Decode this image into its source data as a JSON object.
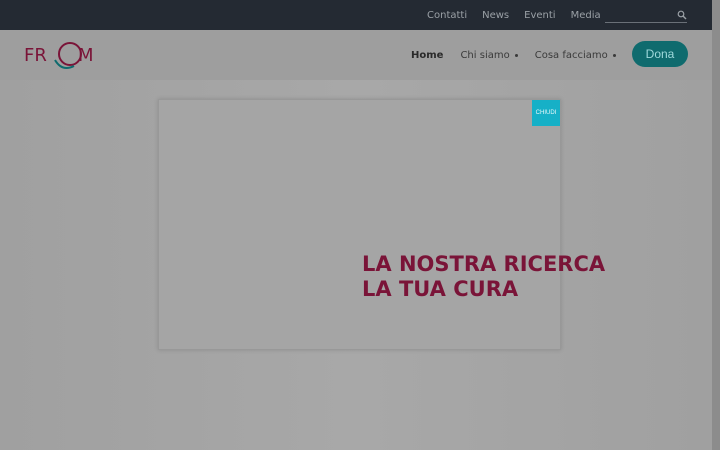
{
  "topbar": {
    "links": [
      "Contatti",
      "News",
      "Eventi",
      "Media"
    ],
    "search_placeholder": ""
  },
  "header": {
    "logo_text": "FROM",
    "nav": [
      {
        "label": "Home",
        "active": true
      },
      {
        "label": "Chi siamo",
        "dropdown": true
      },
      {
        "label": "Cosa facciamo",
        "dropdown": true
      }
    ],
    "donate_label": "Dona"
  },
  "modal": {
    "close_label": "CHIUDI",
    "headline_line1": "LA NOSTRA RICERCA",
    "headline_line2": "LA TUA CURA"
  },
  "colors": {
    "topbar": "#242a33",
    "brand": "#7a1438",
    "donate": "#0f6b6e",
    "close": "#16b0c7"
  }
}
